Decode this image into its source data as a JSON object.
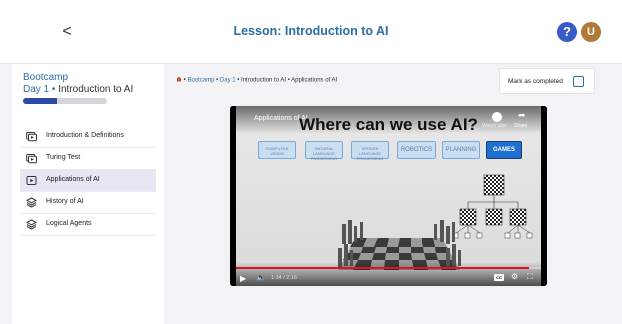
{
  "header": {
    "back_glyph": "<",
    "title": "Lesson: Introduction to AI",
    "help_glyph": "?",
    "avatar_initial": "U"
  },
  "sidebar": {
    "course_title": "Bootcamp",
    "day_label": "Day 1",
    "separator": " • ",
    "lesson_label": "Introduction to AI",
    "progress_fraction": 0.4,
    "items": [
      {
        "label": "Introduction & Definitions",
        "icon": "slides-icon",
        "active": false
      },
      {
        "label": "Turing Test",
        "icon": "slides-icon",
        "active": false
      },
      {
        "label": "Applications of AI",
        "icon": "video-icon",
        "active": true
      },
      {
        "label": "History of AI",
        "icon": "layers-icon",
        "active": false
      },
      {
        "label": "Logical Agents",
        "icon": "layers-icon",
        "active": false
      }
    ]
  },
  "main": {
    "breadcrumb": {
      "sep": " • ",
      "bootcamp": "Bootcamp",
      "day": "Day 1",
      "lesson": "Introduction to AI",
      "current": "Applications of AI"
    },
    "mark_completed_label": "Mark as completed",
    "video": {
      "title": "Applications of AI",
      "headline": "Where can we use AI?",
      "watch_later": "Watch later",
      "share_label": "Share",
      "time": "1:34 / 2:16",
      "progress_fraction": 0.96,
      "cc_label": "CC",
      "topics": [
        "COMPUTER VISION",
        "NATURAL LANGUAGE PROCESSING",
        "SPOKEN LANGUAGE PROCESSING",
        "ROBOTICS",
        "PLANNING",
        "GAMES"
      ]
    }
  },
  "colors": {
    "accent": "#2c6ea6",
    "progress": "#2c49a8",
    "help": "#3a5bc7",
    "avatar": "#b07a3a",
    "seek": "#e0141e"
  }
}
